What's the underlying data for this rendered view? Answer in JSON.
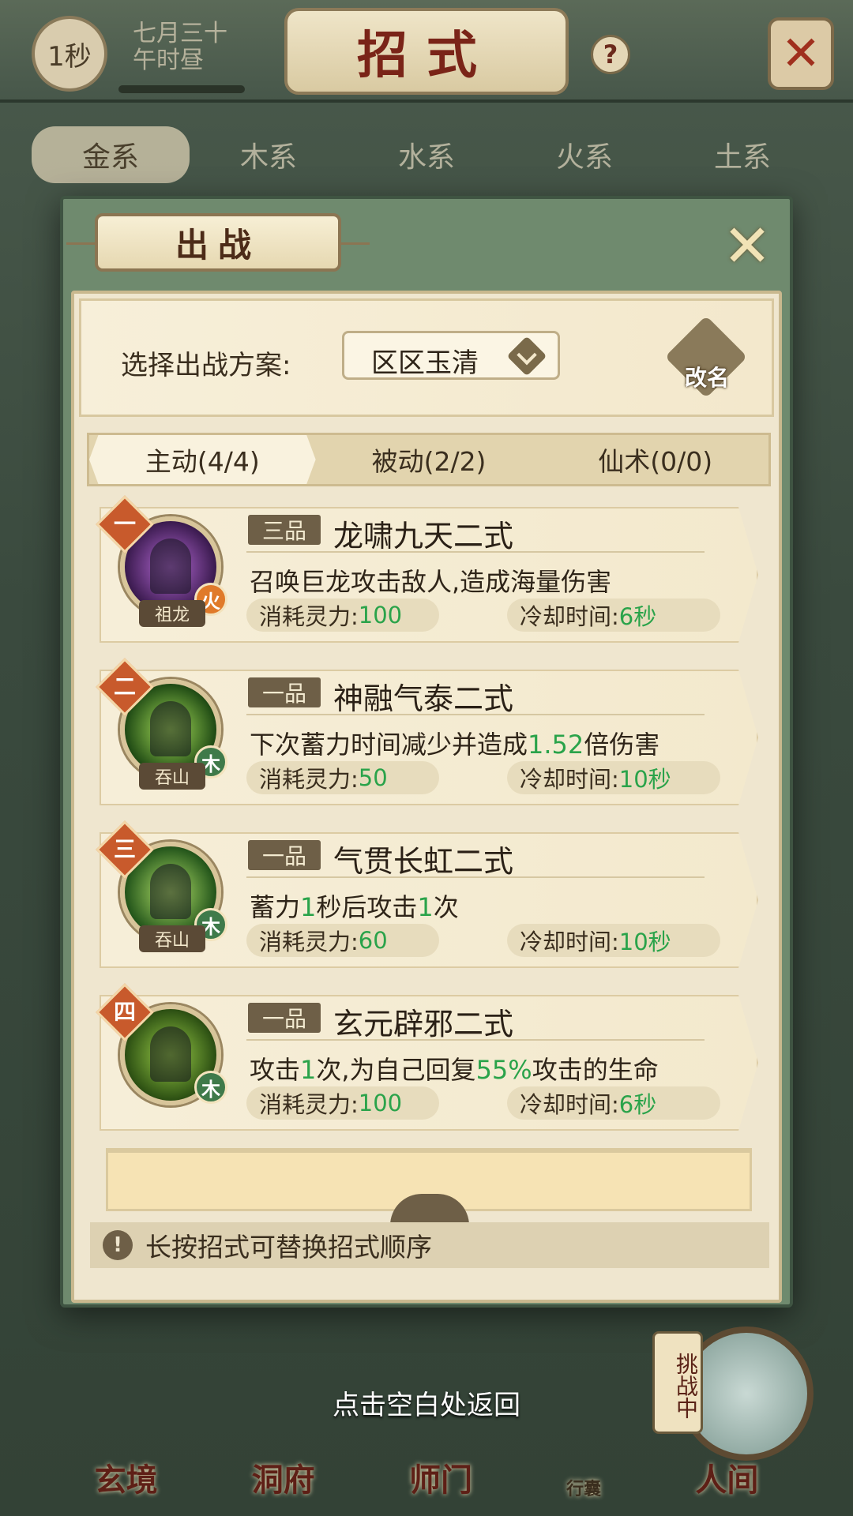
{
  "header": {
    "timer": "1秒",
    "date_line1": "七月三十",
    "date_line2": "午时昼",
    "title": "招式",
    "help": "?"
  },
  "element_tabs": [
    "金系",
    "木系",
    "水系",
    "火系",
    "土系"
  ],
  "modal": {
    "title": "出战",
    "scheme_label": "选择出战方案:",
    "scheme_value": "区区玉清",
    "rename_label": "改名",
    "type_tabs": [
      "主动(4/4)",
      "被动(2/2)",
      "仙术(0/0)"
    ],
    "skills": [
      {
        "rank": "一",
        "owner": "祖龙",
        "element": "火",
        "grade": "三品",
        "name": "龙啸九天二式",
        "desc_parts": [
          "召唤巨龙攻击敌人,造成海量伤害"
        ],
        "cost_label": "消耗灵力:",
        "cost": "100",
        "cd_label": "冷却时间:",
        "cd": "6秒"
      },
      {
        "rank": "二",
        "owner": "吞山",
        "element": "木",
        "grade": "一品",
        "name": "神融气泰二式",
        "desc_parts": [
          "下次蓄力时间减少并造成",
          "1.52",
          "倍伤害"
        ],
        "cost_label": "消耗灵力:",
        "cost": "50",
        "cd_label": "冷却时间:",
        "cd": "10秒"
      },
      {
        "rank": "三",
        "owner": "吞山",
        "element": "木",
        "grade": "一品",
        "name": "气贯长虹二式",
        "desc_parts": [
          "蓄力",
          "1",
          "秒后攻击",
          "1",
          "次"
        ],
        "cost_label": "消耗灵力:",
        "cost": "60",
        "cd_label": "冷却时间:",
        "cd": "10秒"
      },
      {
        "rank": "四",
        "owner": "",
        "element": "木",
        "grade": "一品",
        "name": "玄元辟邪二式",
        "desc_parts": [
          "攻击",
          "1",
          "次,为自己回复",
          "55%",
          "攻击的生命"
        ],
        "cost_label": "消耗灵力:",
        "cost": "100",
        "cd_label": "冷却时间:",
        "cd": "6秒"
      }
    ],
    "tip": "长按招式可替换招式顺序"
  },
  "return_hint": "点击空白处返回",
  "bottom_nav": {
    "items": [
      "玄境",
      "洞府",
      "师门",
      "行囊",
      "人间"
    ],
    "challenge": "挑战中"
  },
  "colors": {
    "highlight_green": "#2aa34a",
    "title_red": "#7a2418",
    "rank_orange": "#c85a2c"
  }
}
